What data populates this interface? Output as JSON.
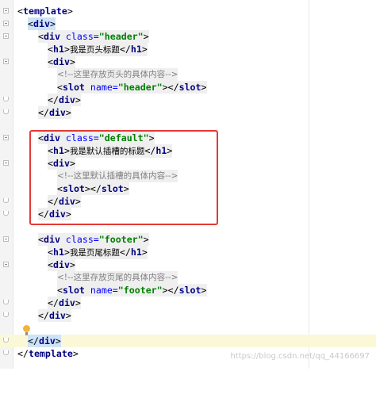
{
  "editor": {
    "lines": [
      {
        "id": "l1",
        "parts": [
          "<",
          "template",
          ">"
        ]
      },
      {
        "id": "l2",
        "parts": [
          "<",
          "div",
          ">"
        ]
      },
      {
        "id": "l3",
        "parts": [
          "<",
          "div ",
          "class=",
          "\"header\"",
          ">"
        ]
      },
      {
        "id": "l4",
        "parts": [
          "<",
          "h1",
          ">",
          "我是页头标题",
          "</",
          "h1",
          ">"
        ]
      },
      {
        "id": "l5",
        "parts": [
          "<",
          "div",
          ">"
        ]
      },
      {
        "id": "l6",
        "parts": [
          "<!--这里存放页头的具体内容-->"
        ]
      },
      {
        "id": "l7",
        "parts": [
          "<",
          "slot ",
          "name=",
          "\"header\"",
          "></",
          "slot",
          ">"
        ]
      },
      {
        "id": "l8",
        "parts": [
          "</",
          "div",
          ">"
        ]
      },
      {
        "id": "l9",
        "parts": [
          "</",
          "div",
          ">"
        ]
      },
      {
        "id": "l10",
        "parts": []
      },
      {
        "id": "l11",
        "parts": [
          "<",
          "div ",
          "class=",
          "\"default\"",
          ">"
        ]
      },
      {
        "id": "l12",
        "parts": [
          "<",
          "h1",
          ">",
          "我是默认插槽的标题",
          "</",
          "h1",
          ">"
        ]
      },
      {
        "id": "l13",
        "parts": [
          "<",
          "div",
          ">"
        ]
      },
      {
        "id": "l14",
        "parts": [
          "<!--这里默认插槽的具体内容-->"
        ]
      },
      {
        "id": "l15",
        "parts": [
          "<",
          "slot",
          "></",
          "slot",
          ">"
        ]
      },
      {
        "id": "l16",
        "parts": [
          "</",
          "div",
          ">"
        ]
      },
      {
        "id": "l17",
        "parts": [
          "</",
          "div",
          ">"
        ]
      },
      {
        "id": "l18",
        "parts": []
      },
      {
        "id": "l19",
        "parts": [
          "<",
          "div ",
          "class=",
          "\"footer\"",
          ">"
        ]
      },
      {
        "id": "l20",
        "parts": [
          "<",
          "h1",
          ">",
          "我是页尾标题",
          "</",
          "h1",
          ">"
        ]
      },
      {
        "id": "l21",
        "parts": [
          "<",
          "div",
          ">"
        ]
      },
      {
        "id": "l22",
        "parts": [
          "<!--这里存放页尾的具体内容-->"
        ]
      },
      {
        "id": "l23",
        "parts": [
          "<",
          "slot ",
          "name=",
          "\"footer\"",
          "></",
          "slot",
          ">"
        ]
      },
      {
        "id": "l24",
        "parts": [
          "</",
          "div",
          ">"
        ]
      },
      {
        "id": "l25",
        "parts": [
          "</",
          "div",
          ">"
        ]
      },
      {
        "id": "l26",
        "parts": []
      },
      {
        "id": "l27",
        "parts": [
          "</",
          "div",
          ">"
        ]
      },
      {
        "id": "l28",
        "parts": [
          "</",
          "template",
          ">"
        ]
      }
    ]
  },
  "watermark": "https://blog.csdn.net/qq_44166697",
  "colors": {
    "tag": "#000080",
    "attribute": "#0000ff",
    "string": "#008000",
    "comment": "#808080",
    "highlight_box": "#e53935",
    "current_line": "#fbf8d8"
  }
}
